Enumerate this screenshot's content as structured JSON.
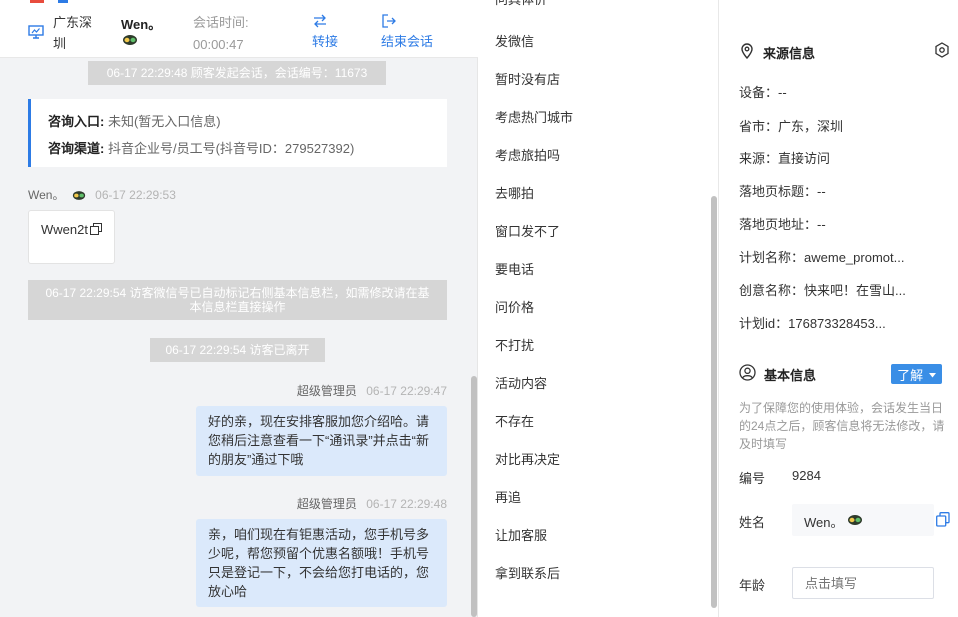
{
  "header": {
    "location": "广东深圳",
    "visitor_name": "Wen。",
    "session_time_label": "会话时间:",
    "session_time_value": "00:00:47",
    "transfer_label": "转接",
    "end_label": "结束会话"
  },
  "chat": {
    "sys_start": "06-17 22:29:48 顾客发起会话，会话编号：11673",
    "entry": {
      "entry_label": "咨询入口:",
      "entry_value": "未知(暂无入口信息)",
      "channel_label": "咨询渠道:",
      "channel_value": "抖音企业号/员工号(抖音号ID：279527392)"
    },
    "visitor_msg": {
      "name": "Wen。",
      "time": "06-17 22:29:53",
      "text": "Wwen2t"
    },
    "sys_wechat": "06-17 22:29:54 访客微信号已自动标记右侧基本信息栏，如需修改请在基本信息栏直接操作",
    "sys_left": "06-17 22:29:54 访客已离开",
    "agent_msgs": [
      {
        "name": "超级管理员",
        "time": "06-17 22:29:47",
        "text": "好的亲，现在安排客服加您介绍哈。请您稍后注意查看一下“通讯录”并点击“新的朋友”通过下哦"
      },
      {
        "name": "超级管理员",
        "time": "06-17 22:29:48",
        "text": "亲，咱们现在有钜惠活动，您手机号多少呢，帮您预留个优惠名额哦！手机号只是登记一下，不会给您打电话的，您放心哈"
      }
    ]
  },
  "quick_replies": {
    "partial_top": "问具体价",
    "items": [
      "发微信",
      "暂时没有店",
      "考虑热门城市",
      "考虑旅拍吗",
      "去哪拍",
      "窗口发不了",
      "要电话",
      "问价格",
      "不打扰",
      "活动内容",
      "不存在",
      "对比再决定",
      "再追",
      "让加客服",
      "拿到联系后"
    ]
  },
  "source_info": {
    "title": "来源信息",
    "rows": [
      {
        "label": "设备：",
        "value": "--"
      },
      {
        "label": "省市：",
        "value": "广东，深圳"
      },
      {
        "label": "来源：",
        "value": "直接访问"
      },
      {
        "label": "落地页标题：",
        "value": "--"
      },
      {
        "label": "落地页地址：",
        "value": "--"
      },
      {
        "label": "计划名称：",
        "value": "aweme_promot..."
      },
      {
        "label": "创意名称：",
        "value": "快来吧！在雪山..."
      },
      {
        "label": "计划id：",
        "value": "176873328453..."
      }
    ]
  },
  "basic_info": {
    "title": "基本信息",
    "learn_button": "了解",
    "notice": "为了保障您的使用体验，会话发生当日的24点之后，顾客信息将无法修改，请及时填写",
    "id_label": "编号",
    "id_value": "9284",
    "name_label": "姓名",
    "name_value": "Wen。",
    "age_label": "年龄",
    "age_placeholder": "点击填写"
  },
  "colors": {
    "accent": "#2d7be5",
    "learn_btn_bg": "#3a8ee6",
    "agent_bubble": "#dbe9fb",
    "entry_border": "#2d7be5",
    "system_msg_bg": "#d6d6d6"
  }
}
